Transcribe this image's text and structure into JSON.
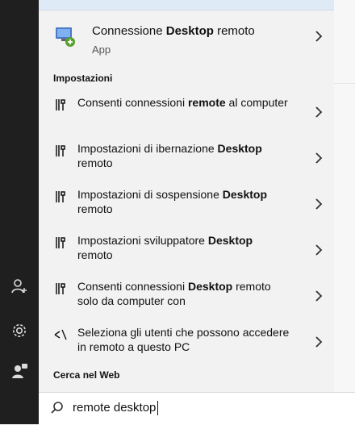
{
  "app_result": {
    "title_prefix": "Connessione ",
    "title_bold": "Desktop",
    "title_suffix": " remoto",
    "subtitle": "App"
  },
  "sections": {
    "settings_title": "Impostazioni",
    "web_title": "Cerca nel Web"
  },
  "settings_items": [
    {
      "prefix": "Consenti connessioni ",
      "bold": "remote",
      "suffix": " al computer",
      "icon": "settings-icon"
    },
    {
      "prefix": "Impostazioni di ibernazione ",
      "bold": "Desktop",
      "suffix": " remoto",
      "icon": "settings-icon"
    },
    {
      "prefix": "Impostazioni di sospensione ",
      "bold": "Desktop",
      "suffix": " remoto",
      "icon": "settings-icon"
    },
    {
      "prefix": "Impostazioni sviluppatore ",
      "bold": "Desktop",
      "suffix": " remoto",
      "icon": "settings-icon"
    },
    {
      "prefix": "Consenti connessioni ",
      "bold": "Desktop",
      "suffix": " remoto solo da computer con",
      "icon": "settings-icon"
    },
    {
      "prefix": "Seleziona gli utenti che possono accedere in remoto a questo PC",
      "bold": "",
      "suffix": "",
      "icon": "remote-users-icon"
    }
  ],
  "search": {
    "query": "remote desktop"
  }
}
